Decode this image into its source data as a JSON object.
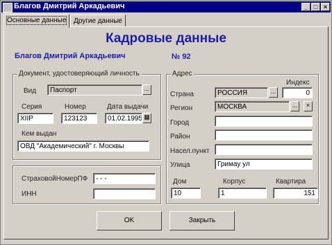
{
  "window": {
    "title": "Благов Дмитрий Аркадьевич",
    "btn_min": "_",
    "btn_max": "□",
    "btn_close": "×"
  },
  "tabs": [
    {
      "label": "Основные данные"
    },
    {
      "label": "Другие данные"
    }
  ],
  "header": {
    "title": "Кадровые данные",
    "person_name": "Благов Дмитрий Аркадьевич",
    "record_number": "№ 92"
  },
  "document": {
    "group_title": "Документ, удостоверяющий личность",
    "type_label": "Вид",
    "type_value": "Паспорт",
    "series_label": "Серия",
    "series_value": "XIIP",
    "number_label": "Номер",
    "number_value": "123123",
    "issue_date_label": "Дата выдачи",
    "issue_date_value": "01.02.1995",
    "issued_by_label": "Кем выдан",
    "issued_by_value": "ОВД \"Академический\" г. Москвы"
  },
  "insurance": {
    "pfr_label": "СтраховойНомерПФ",
    "pfr_value": "- - -",
    "inn_label": "ИНН",
    "inn_value": ""
  },
  "address": {
    "group_title": "Адрес",
    "index_label": "Индекс",
    "index_value": "0",
    "country_label": "Страна",
    "country_value": "РОССИЯ",
    "region_label": "Регион",
    "region_value": "МОСКВА",
    "city_label": "Город",
    "city_value": "",
    "district_label": "Район",
    "district_value": "",
    "settlement_label": "Насел.пункт",
    "settlement_value": "",
    "street_label": "Улица",
    "street_value": "Гримау ул",
    "house_label": "Дом",
    "house_value": "10",
    "building_label": "Корпус",
    "building_value": "1",
    "flat_label": "Квартира",
    "flat_value": "151"
  },
  "buttons": {
    "ok": "OK",
    "close": "Закрыть",
    "ellipsis": "...",
    "clear": "×",
    "calendar": "▦"
  }
}
